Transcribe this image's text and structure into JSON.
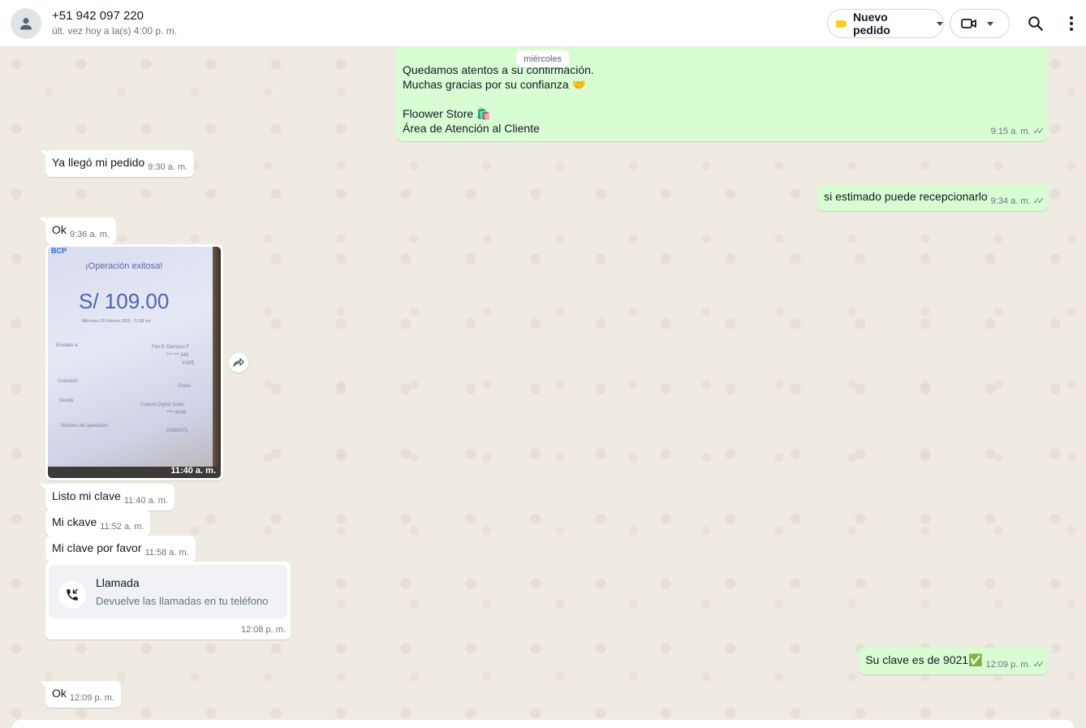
{
  "header": {
    "contact_name": "+51 942 097 220",
    "contact_status": "últ. vez hoy a la(s) 4:00 p. m.",
    "label_button": "Nuevo pedido",
    "label_color": "#f7d01e"
  },
  "chat": {
    "date_chip": "miércoles",
    "first_out": {
      "line1": "Quedamos atentos a su confirmación.",
      "line2": "Muchas gracias por su confianza 🤝",
      "line3": "Floower Store 🛍️",
      "line4": "Área de Atención al Cliente",
      "time": "9:15 a. m."
    },
    "messages": [
      {
        "text": "Ya llegó mi pedido",
        "time": "9:30 a. m."
      },
      {
        "text": "si estimado puede recepcionarlo",
        "time": "9:34 a. m."
      },
      {
        "text": "Ok",
        "time": "9:36 a. m."
      },
      {
        "text": "Listo mi clave",
        "time": "11:40 a. m."
      },
      {
        "text": "Mi ckave",
        "time": "11:52 a. m."
      },
      {
        "text": "Mi clave por favor",
        "time": "11:58 a. m."
      },
      {
        "text": "Su clave es de 9021✅",
        "time": "12:09 p. m."
      },
      {
        "text": "Ok",
        "time": "12:09 p. m."
      }
    ],
    "image_message": {
      "brand": "BCP",
      "title": "¡Operación exitosa!",
      "amount": "S/ 109.00",
      "date_line": "Miércoles 25 Febrero 2025 - 11:38 am",
      "rows": [
        {
          "label": "Enviado a",
          "value": "Flor E Garriazo F"
        },
        {
          "label": "",
          "value": "*** *** 249"
        },
        {
          "label": "",
          "value": "YAPE"
        },
        {
          "label": "Comisión",
          "value": "Gratis"
        },
        {
          "label": "Desde",
          "value": "Cuenta Digital Soles"
        },
        {
          "label": "",
          "value": "**** 8066"
        },
        {
          "label": "Número de operación",
          "value": "01693071"
        }
      ],
      "time": "11:40 a. m."
    },
    "call_message": {
      "title": "Llamada",
      "subtitle": "Devuelve las llamadas en tu teléfono",
      "time": "12:08 p. m."
    }
  }
}
